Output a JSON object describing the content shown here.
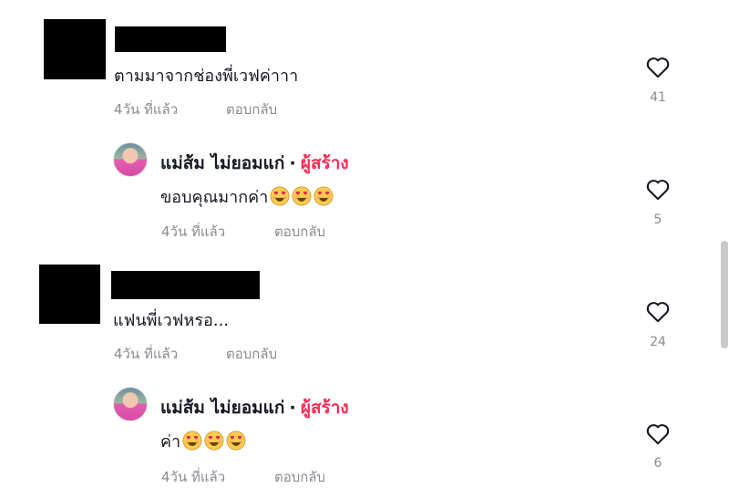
{
  "comments": [
    {
      "text": "ตามมาจากช่องพี่เวฟค่าาา",
      "time": "4วัน ที่แล้ว",
      "reply_label": "ตอบกลับ",
      "likes": "41"
    },
    {
      "author": "แม่ส้ม ไม่ยอมแก่",
      "separator": "·",
      "creator_badge": "ผู้สร้าง",
      "text": "ขอบคุณมากค่า",
      "emoji_count": 3,
      "time": "4วัน ที่แล้ว",
      "reply_label": "ตอบกลับ",
      "likes": "5"
    },
    {
      "text": "แฟนพี่เวฟหรอ...",
      "time": "4วัน ที่แล้ว",
      "reply_label": "ตอบกลับ",
      "likes": "24"
    },
    {
      "author": "แม่ส้ม ไม่ยอมแก่",
      "separator": "·",
      "creator_badge": "ผู้สร้าง",
      "text": "ค่า",
      "emoji_count": 3,
      "time": "4วัน ที่แล้ว",
      "reply_label": "ตอบกลับ",
      "likes": "6"
    }
  ],
  "icons": {
    "like": "heart-outline-icon",
    "emoji": "smiling-face-with-heart-eyes-icon"
  },
  "colors": {
    "creator_badge": "#fe2c55",
    "meta_text": "#8a8b91",
    "text": "#161823"
  }
}
